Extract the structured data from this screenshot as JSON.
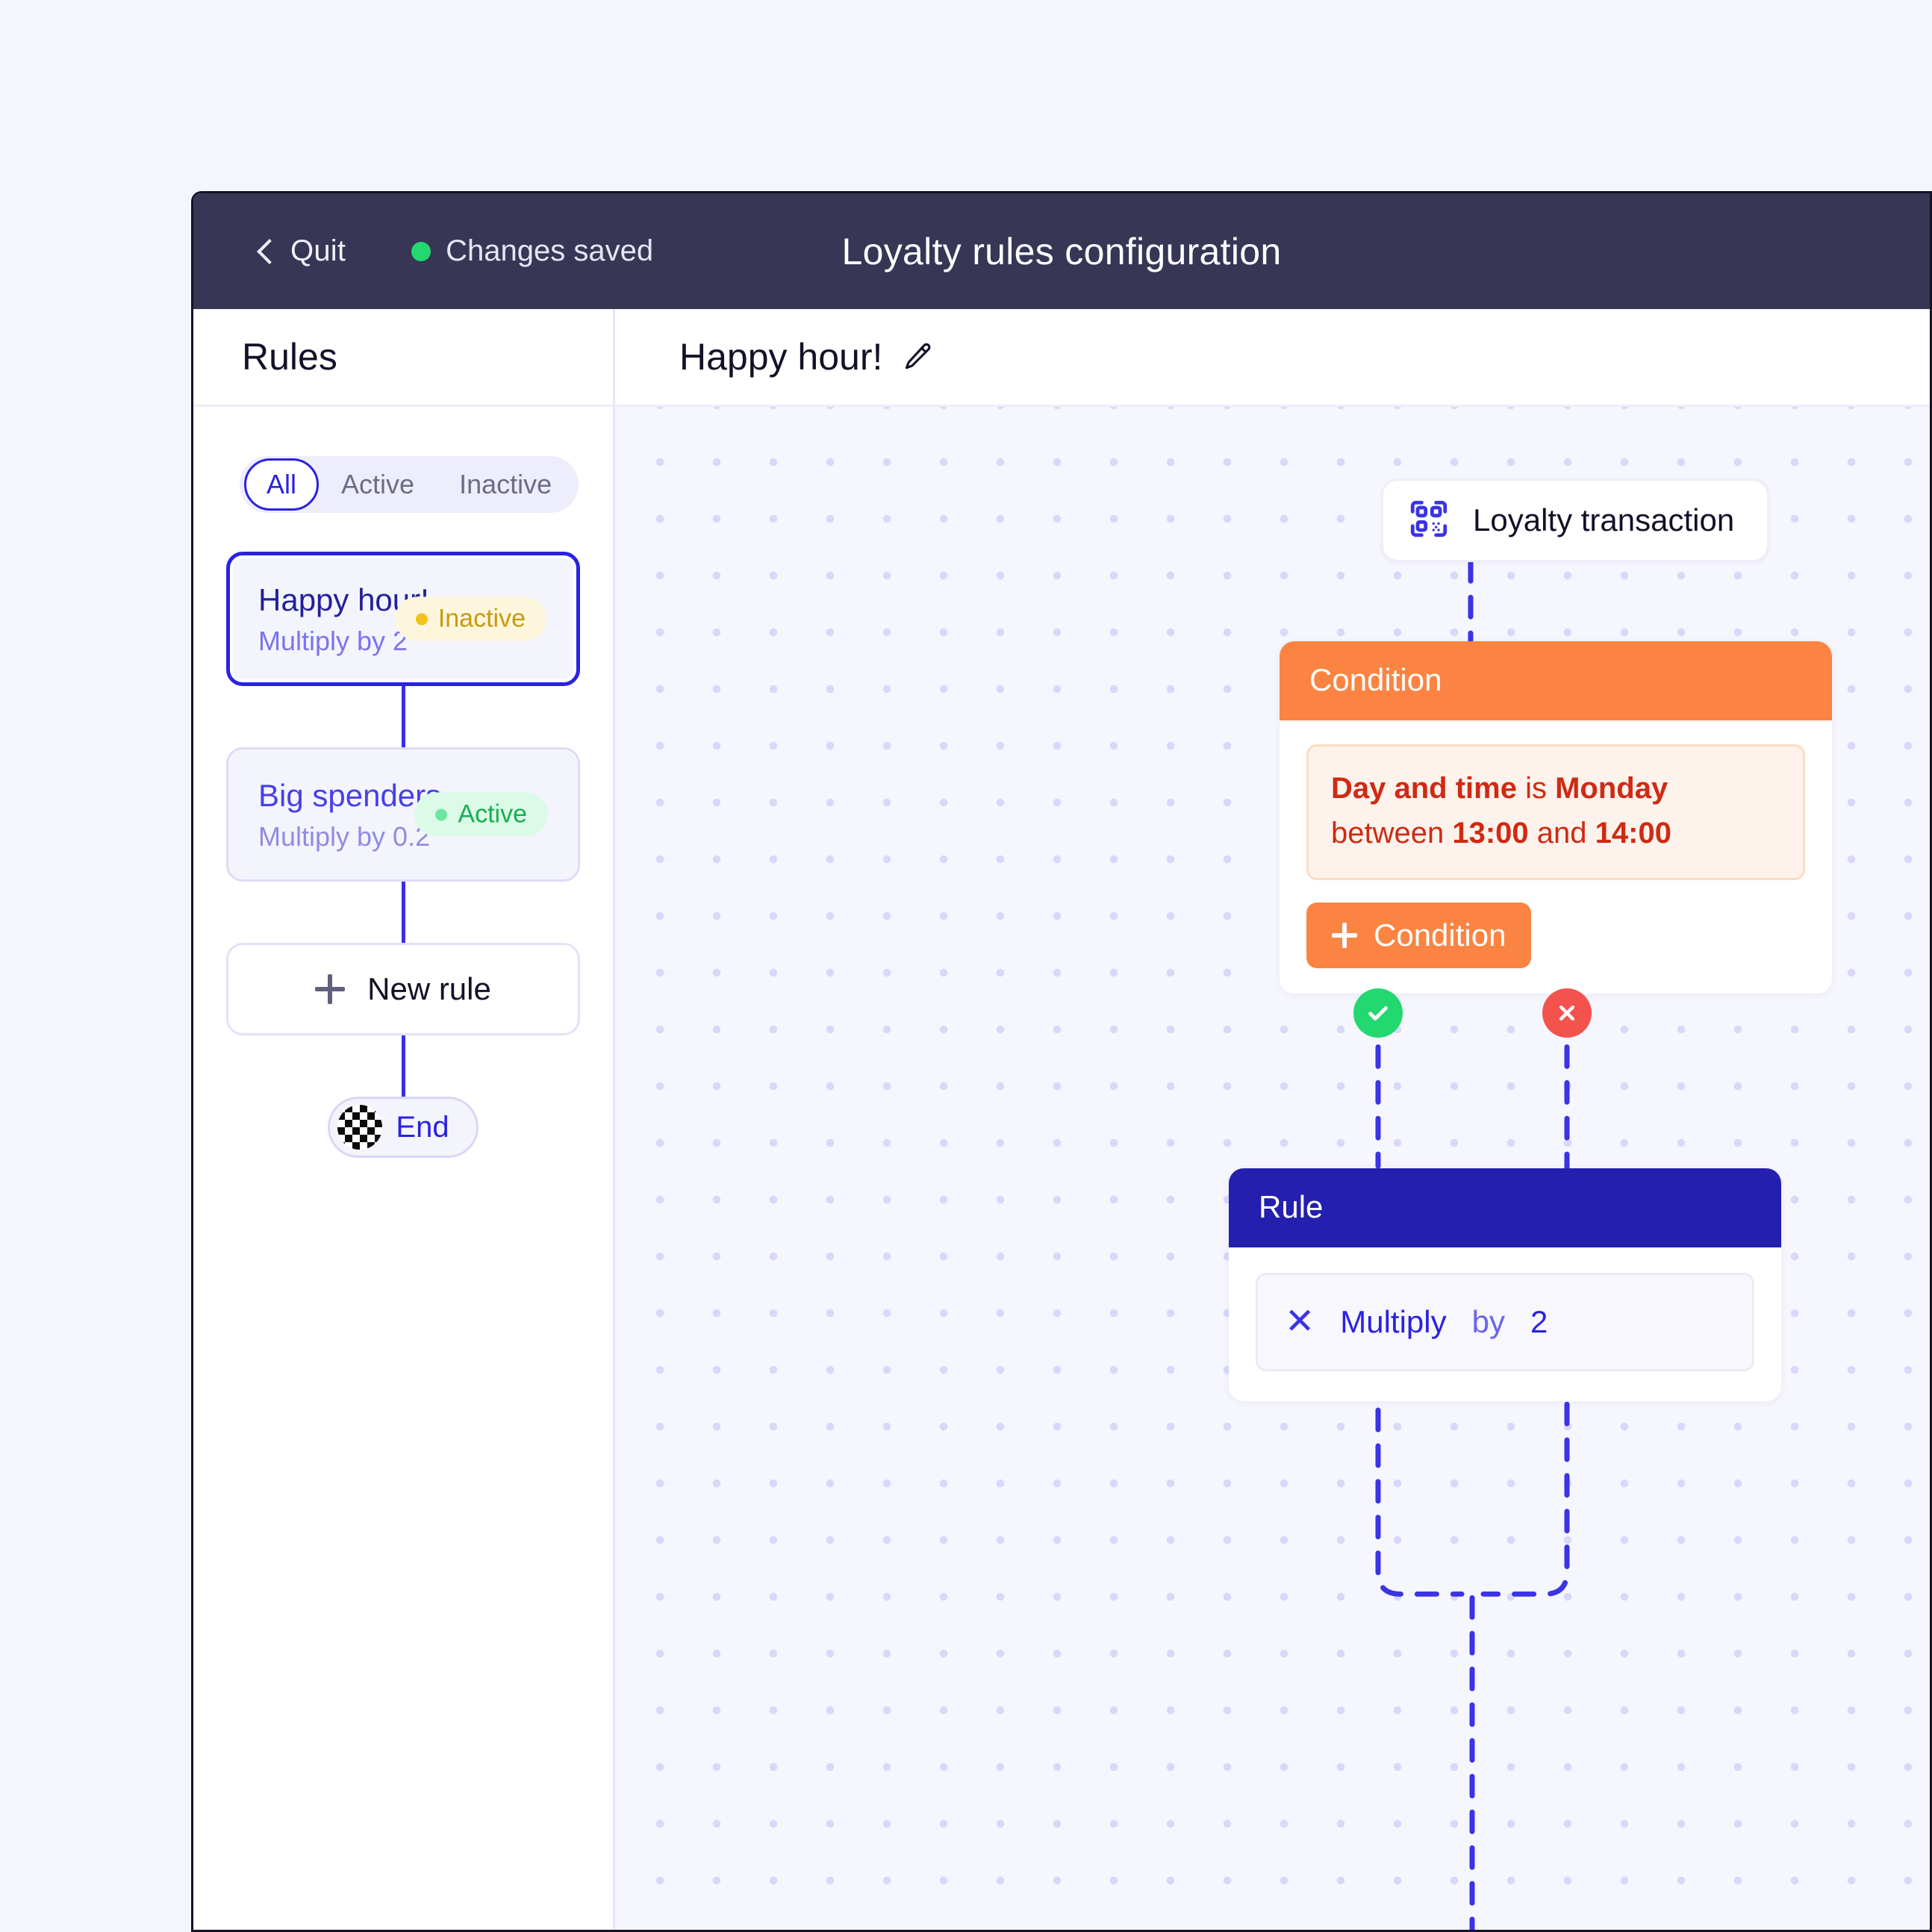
{
  "topbar": {
    "quit_label": "Quit",
    "back_icon": "chevron-left-icon",
    "status_label": "Changes saved",
    "status_color": "#22d86f",
    "title": "Loyalty rules configuration"
  },
  "sidebar": {
    "heading": "Rules",
    "filters": [
      {
        "label": "All",
        "selected": true
      },
      {
        "label": "Active",
        "selected": false
      },
      {
        "label": "Inactive",
        "selected": false
      }
    ],
    "rules": [
      {
        "name": "Happy hour!",
        "subtitle": "Multiply by 2",
        "status": "Inactive",
        "status_color": "#f2c318",
        "selected": true
      },
      {
        "name": "Big spenders",
        "subtitle": "Multiply by 0.2",
        "status": "Active",
        "status_color": "#6fe6a0",
        "selected": false
      }
    ],
    "new_rule_label": "New rule",
    "new_rule_icon": "plus-icon",
    "end_label": "End",
    "end_icon": "checkered-flag-icon"
  },
  "canvas": {
    "title": "Happy hour!",
    "edit_icon": "pencil-icon",
    "trigger": {
      "label": "Loyalty transaction",
      "icon": "qr-scan-icon",
      "icon_color": "#3b33e6"
    },
    "condition": {
      "header": "Condition",
      "header_color": "#fb8442",
      "expression": {
        "field": "Day and time",
        "operator": "is",
        "value": "Monday",
        "between_label": "between",
        "time_from": "13:00",
        "and_label": "and",
        "time_to": "14:00"
      },
      "add_button": "Condition",
      "add_button_icon": "plus-icon",
      "true_badge_icon": "check-icon",
      "true_badge_color": "#22d86f",
      "false_badge_icon": "close-icon",
      "false_badge_color": "#f4524d"
    },
    "rule": {
      "header": "Rule",
      "header_color": "#241fae",
      "action_icon": "multiply-icon",
      "action_label": "Multiply",
      "action_preposition": "by",
      "action_value": "2"
    }
  }
}
